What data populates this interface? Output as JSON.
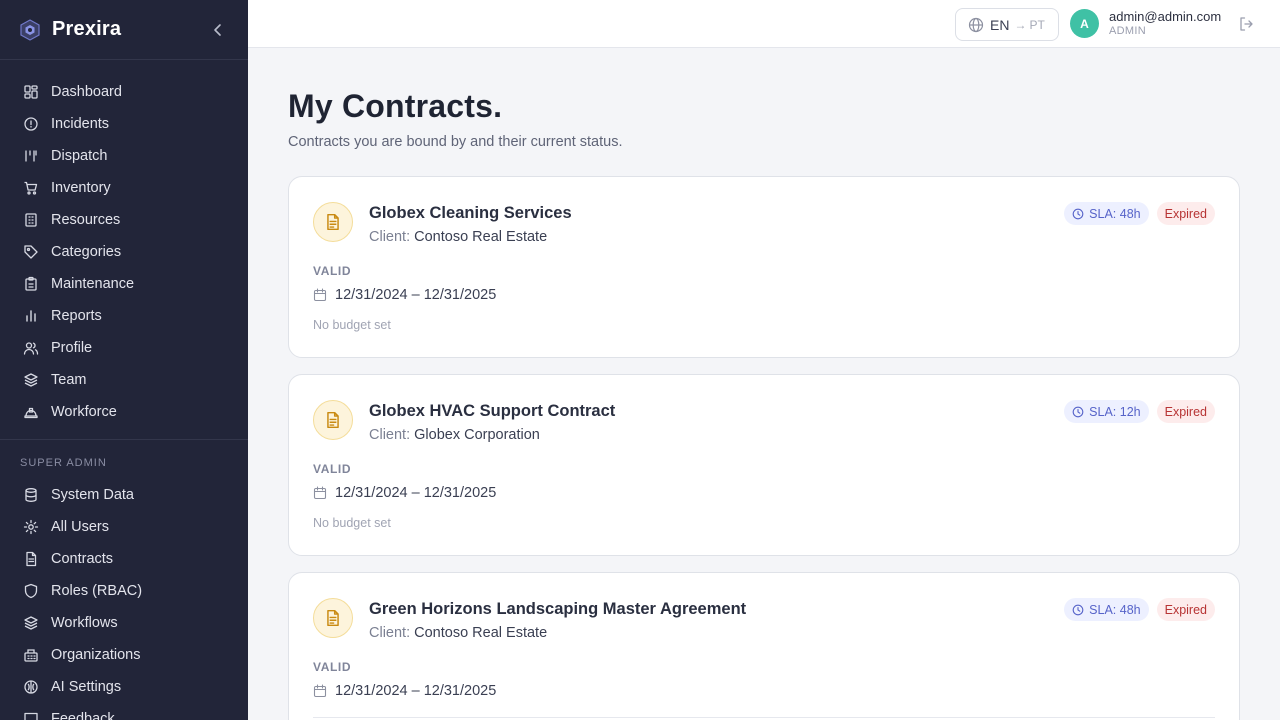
{
  "brand": {
    "name": "Prexira"
  },
  "sidebar": {
    "items": [
      {
        "label": "Dashboard",
        "icon": "dashboard-icon"
      },
      {
        "label": "Incidents",
        "icon": "alert-circle-icon"
      },
      {
        "label": "Dispatch",
        "icon": "dispatch-icon"
      },
      {
        "label": "Inventory",
        "icon": "cart-icon"
      },
      {
        "label": "Resources",
        "icon": "building-icon"
      },
      {
        "label": "Categories",
        "icon": "tag-icon"
      },
      {
        "label": "Maintenance",
        "icon": "clipboard-icon"
      },
      {
        "label": "Reports",
        "icon": "bar-chart-icon"
      },
      {
        "label": "Profile",
        "icon": "users-icon"
      },
      {
        "label": "Team",
        "icon": "layers-icon"
      },
      {
        "label": "Workforce",
        "icon": "hard-hat-icon"
      }
    ],
    "super_admin_label": "SUPER ADMIN",
    "admin_items": [
      {
        "label": "System Data",
        "icon": "database-icon"
      },
      {
        "label": "All Users",
        "icon": "gear-icon"
      },
      {
        "label": "Contracts",
        "icon": "file-text-icon"
      },
      {
        "label": "Roles (RBAC)",
        "icon": "shield-icon"
      },
      {
        "label": "Workflows",
        "icon": "layers-icon"
      },
      {
        "label": "Organizations",
        "icon": "organization-icon"
      },
      {
        "label": "AI Settings",
        "icon": "brain-icon"
      },
      {
        "label": "Feedback",
        "icon": "message-square-icon"
      }
    ]
  },
  "topbar": {
    "language": {
      "current": "EN",
      "arrow": "→",
      "next": "PT"
    },
    "user": {
      "initial": "A",
      "email": "admin@admin.com",
      "role": "ADMIN"
    }
  },
  "page": {
    "title": "My Contracts.",
    "subtitle": "Contracts you are bound by and their current status."
  },
  "contracts": [
    {
      "title": "Globex Cleaning Services",
      "client_prefix": "Client:",
      "client": "Contoso Real Estate",
      "sla": "SLA: 48h",
      "status": "Expired",
      "valid_label": "VALID",
      "valid_range": "12/31/2024 – 12/31/2025",
      "budget": "No budget set"
    },
    {
      "title": "Globex HVAC Support Contract",
      "client_prefix": "Client:",
      "client": "Globex Corporation",
      "sla": "SLA: 12h",
      "status": "Expired",
      "valid_label": "VALID",
      "valid_range": "12/31/2024 – 12/31/2025",
      "budget": "No budget set"
    },
    {
      "title": "Green Horizons Landscaping Master Agreement",
      "client_prefix": "Client:",
      "client": "Contoso Real Estate",
      "sla": "SLA: 48h",
      "status": "Expired",
      "valid_label": "VALID",
      "valid_range": "12/31/2024 – 12/31/2025",
      "budget": ""
    }
  ],
  "colors": {
    "sidebar_bg": "#222539",
    "page_bg": "#f4f5f8",
    "sla_badge_text": "#5663c9",
    "expired_badge_text": "#b73434",
    "avatar": "#3fc1a5",
    "contract_icon": "#c98a12"
  }
}
